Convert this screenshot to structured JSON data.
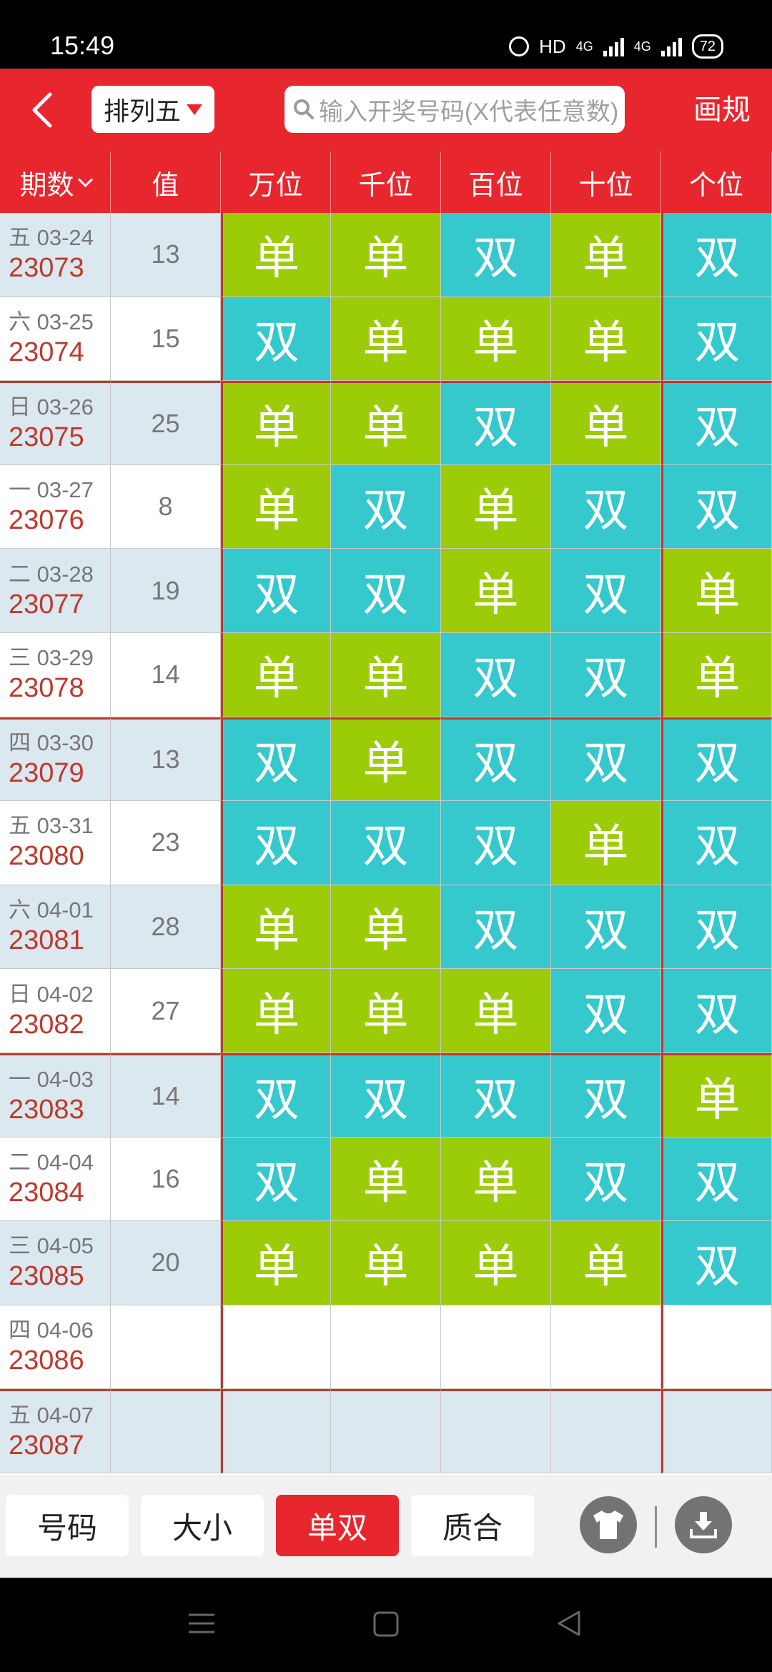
{
  "status_bar": {
    "time": "15:49",
    "hd": "HD",
    "net1": "4G",
    "net2": "4G",
    "battery": "72"
  },
  "header": {
    "lottery": "排列五",
    "search_placeholder": "输入开奖号码(X代表任意数)",
    "right_action": "画规"
  },
  "columns": {
    "period": "期数",
    "value": "值",
    "pos1": "万位",
    "pos2": "千位",
    "pos3": "百位",
    "pos4": "十位",
    "pos5": "个位"
  },
  "rows": [
    {
      "date": "五 03-24",
      "issue": "23073",
      "value": "13",
      "c": [
        "单",
        "单",
        "双",
        "单",
        "双"
      ]
    },
    {
      "date": "六 03-25",
      "issue": "23074",
      "value": "15",
      "c": [
        "双",
        "单",
        "单",
        "单",
        "双"
      ]
    },
    {
      "date": "日 03-26",
      "issue": "23075",
      "value": "25",
      "c": [
        "单",
        "单",
        "双",
        "单",
        "双"
      ]
    },
    {
      "date": "一 03-27",
      "issue": "23076",
      "value": "8",
      "c": [
        "单",
        "双",
        "单",
        "双",
        "双"
      ]
    },
    {
      "date": "二 03-28",
      "issue": "23077",
      "value": "19",
      "c": [
        "双",
        "双",
        "单",
        "双",
        "单"
      ]
    },
    {
      "date": "三 03-29",
      "issue": "23078",
      "value": "14",
      "c": [
        "单",
        "单",
        "双",
        "双",
        "单"
      ]
    },
    {
      "date": "四 03-30",
      "issue": "23079",
      "value": "13",
      "c": [
        "双",
        "单",
        "双",
        "双",
        "双"
      ]
    },
    {
      "date": "五 03-31",
      "issue": "23080",
      "value": "23",
      "c": [
        "双",
        "双",
        "双",
        "单",
        "双"
      ]
    },
    {
      "date": "六 04-01",
      "issue": "23081",
      "value": "28",
      "c": [
        "单",
        "单",
        "双",
        "双",
        "双"
      ]
    },
    {
      "date": "日 04-02",
      "issue": "23082",
      "value": "27",
      "c": [
        "单",
        "单",
        "单",
        "双",
        "双"
      ]
    },
    {
      "date": "一 04-03",
      "issue": "23083",
      "value": "14",
      "c": [
        "双",
        "双",
        "双",
        "双",
        "单"
      ]
    },
    {
      "date": "二 04-04",
      "issue": "23084",
      "value": "16",
      "c": [
        "双",
        "单",
        "单",
        "双",
        "双"
      ]
    },
    {
      "date": "三 04-05",
      "issue": "23085",
      "value": "20",
      "c": [
        "单",
        "单",
        "单",
        "单",
        "双"
      ]
    },
    {
      "date": "四 04-06",
      "issue": "23086",
      "value": "",
      "c": [
        "",
        "",
        "",
        "",
        ""
      ]
    },
    {
      "date": "五 04-07",
      "issue": "23087",
      "value": "",
      "c": [
        "",
        "",
        "",
        "",
        ""
      ]
    }
  ],
  "tabs": {
    "items": [
      "号码",
      "大小",
      "单双",
      "质合"
    ],
    "active": "单双"
  },
  "colors": {
    "primary": "#e8262e",
    "odd": "#9ccc08",
    "even": "#35c8cd",
    "band": "#dbe8f0",
    "issue_text": "#c0392b"
  },
  "icons": {
    "back": "back-arrow-icon",
    "search": "search-icon",
    "skin": "tshirt-icon",
    "download": "download-icon"
  }
}
